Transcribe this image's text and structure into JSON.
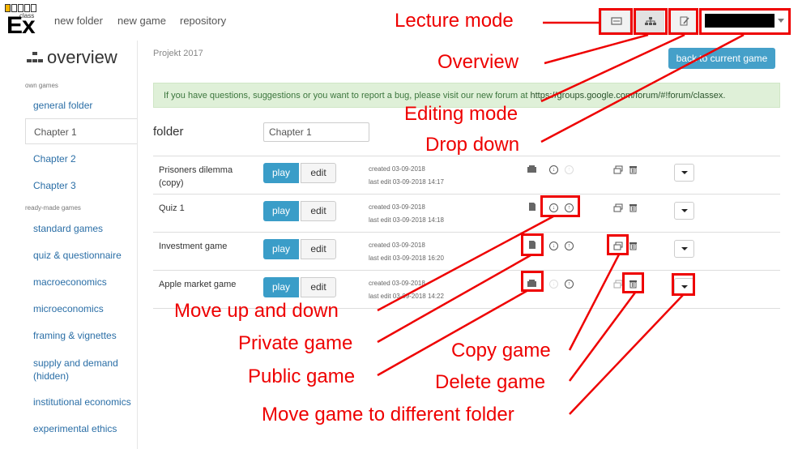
{
  "nav": {
    "logo_text": "Ex",
    "logo_small": "class",
    "links": [
      "new folder",
      "new game",
      "repository"
    ]
  },
  "sidebar": {
    "title": "overview",
    "sections": [
      {
        "label": "own games",
        "items": [
          "general folder",
          "Chapter 1",
          "Chapter 2",
          "Chapter 3"
        ]
      },
      {
        "label": "ready-made games",
        "items": [
          "standard games",
          "quiz & questionnaire",
          "macroeconomics",
          "microeconomics",
          "framing & vignettes",
          "supply and demand (hidden)",
          "institutional economics",
          "experimental ethics"
        ]
      }
    ],
    "active_item": "Chapter 1"
  },
  "main": {
    "breadcrumb": "Projekt 2017",
    "back_button": "back to current game",
    "alert_text": "If you have questions, suggestions or you want to report a bug, please visit our new forum at ",
    "alert_link": "https://groups.google.com/forum/#!forum/classex.",
    "folder_label": "folder",
    "folder_value": "Chapter 1",
    "play_label": "play",
    "edit_label": "edit",
    "games": [
      {
        "name": "Prisoners dilemma (copy)",
        "created": "created 03-09-2018",
        "edited": "last edit 03-09-2018 14:17"
      },
      {
        "name": "Quiz 1",
        "created": "created 03-09-2018",
        "edited": "last edit 03-09-2018 14:18"
      },
      {
        "name": "Investment game",
        "created": "created 03-09-2018",
        "edited": "last edit 03-09-2018 16:20"
      },
      {
        "name": "Apple market game",
        "created": "created 03-09-2018",
        "edited": "last edit 03-09-2018 14:22"
      }
    ]
  },
  "annotations": {
    "lecture_mode": "Lecture mode",
    "overview": "Overview",
    "editing_mode": "Editing mode",
    "drop_down": "Drop down",
    "move_up_down": "Move up and down",
    "private_game": "Private game",
    "public_game": "Public game",
    "copy_game": "Copy game",
    "delete_game": "Delete game",
    "move_folder": "Move game to different folder"
  },
  "colors": {
    "accent": "#3a9dc8",
    "annotation": "#ee0000",
    "alert_bg": "#dff0d8",
    "link": "#2a6ea6"
  }
}
